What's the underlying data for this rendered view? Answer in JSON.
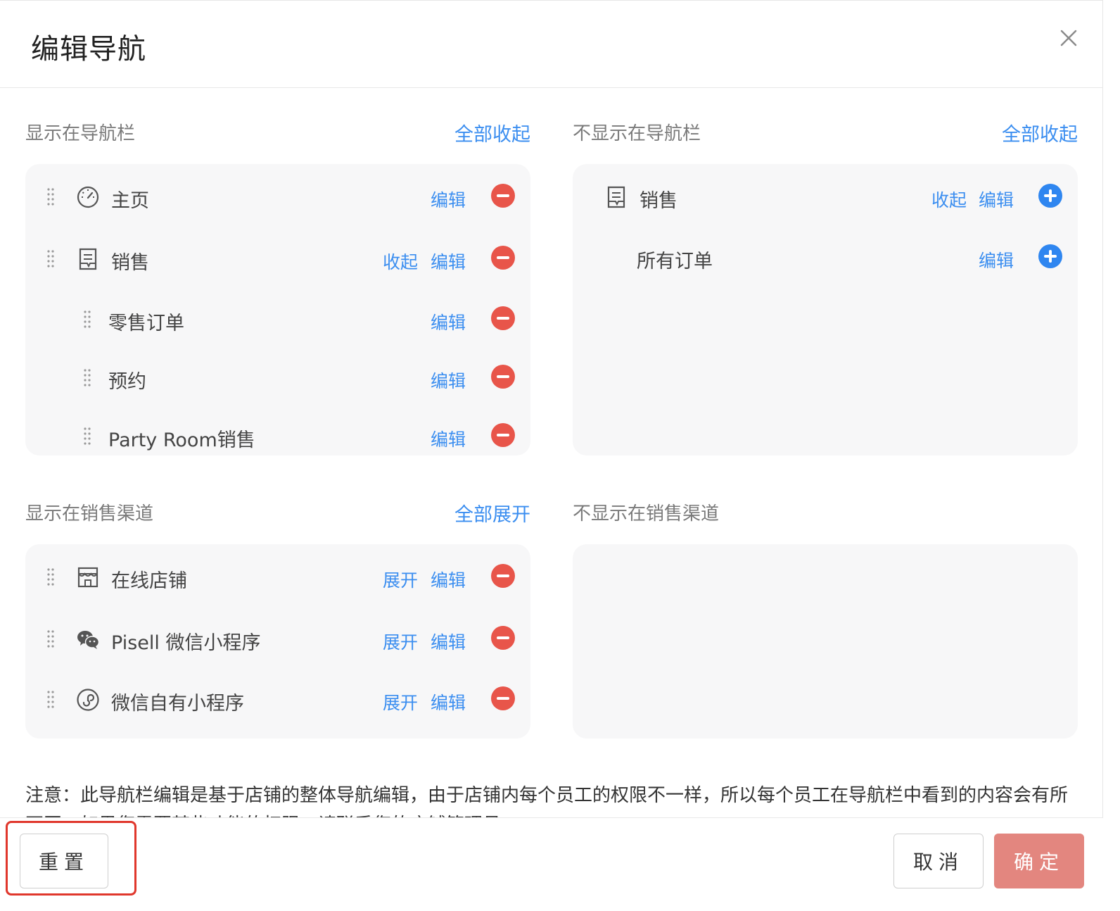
{
  "dialog": {
    "title": "编辑导航"
  },
  "nav_shown": {
    "label": "显示在导航栏",
    "action": "全部收起",
    "items": [
      {
        "label": "主页",
        "icon": "dashboard-icon",
        "edit": "编辑"
      },
      {
        "label": "销售",
        "icon": "document-icon",
        "toggle": "收起",
        "edit": "编辑"
      },
      {
        "label": "零售订单",
        "edit": "编辑"
      },
      {
        "label": "预约",
        "edit": "编辑"
      },
      {
        "label": "Party Room销售",
        "edit": "编辑"
      }
    ]
  },
  "nav_hidden": {
    "label": "不显示在导航栏",
    "action": "全部收起",
    "items": [
      {
        "label": "销售",
        "icon": "document-icon",
        "toggle": "收起",
        "edit": "编辑"
      },
      {
        "label": "所有订单",
        "edit": "编辑"
      }
    ]
  },
  "channel_shown": {
    "label": "显示在销售渠道",
    "action": "全部展开",
    "items": [
      {
        "label": "在线店铺",
        "icon": "store-icon",
        "toggle": "展开",
        "edit": "编辑"
      },
      {
        "label": "Pisell 微信小程序",
        "icon": "wechat-icon",
        "toggle": "展开",
        "edit": "编辑"
      },
      {
        "label": "微信自有小程序",
        "icon": "mini-program-icon",
        "toggle": "展开",
        "edit": "编辑"
      }
    ]
  },
  "channel_hidden": {
    "label": "不显示在销售渠道"
  },
  "note": "注意：此导航栏编辑是基于店铺的整体导航编辑，由于店铺内每个员工的权限不一样，所以每个员工在导航栏中看到的内容会有所不同，如果您需要某些功能的权限，请联系您的店铺管理员。",
  "footer": {
    "reset": "重置",
    "cancel": "取消",
    "confirm": "确定"
  },
  "colors": {
    "link": "#3b8ef0",
    "remove": "#e8554a",
    "add": "#2f86f0",
    "confirm_bg": "#e3867f",
    "highlight": "#e0372c"
  }
}
